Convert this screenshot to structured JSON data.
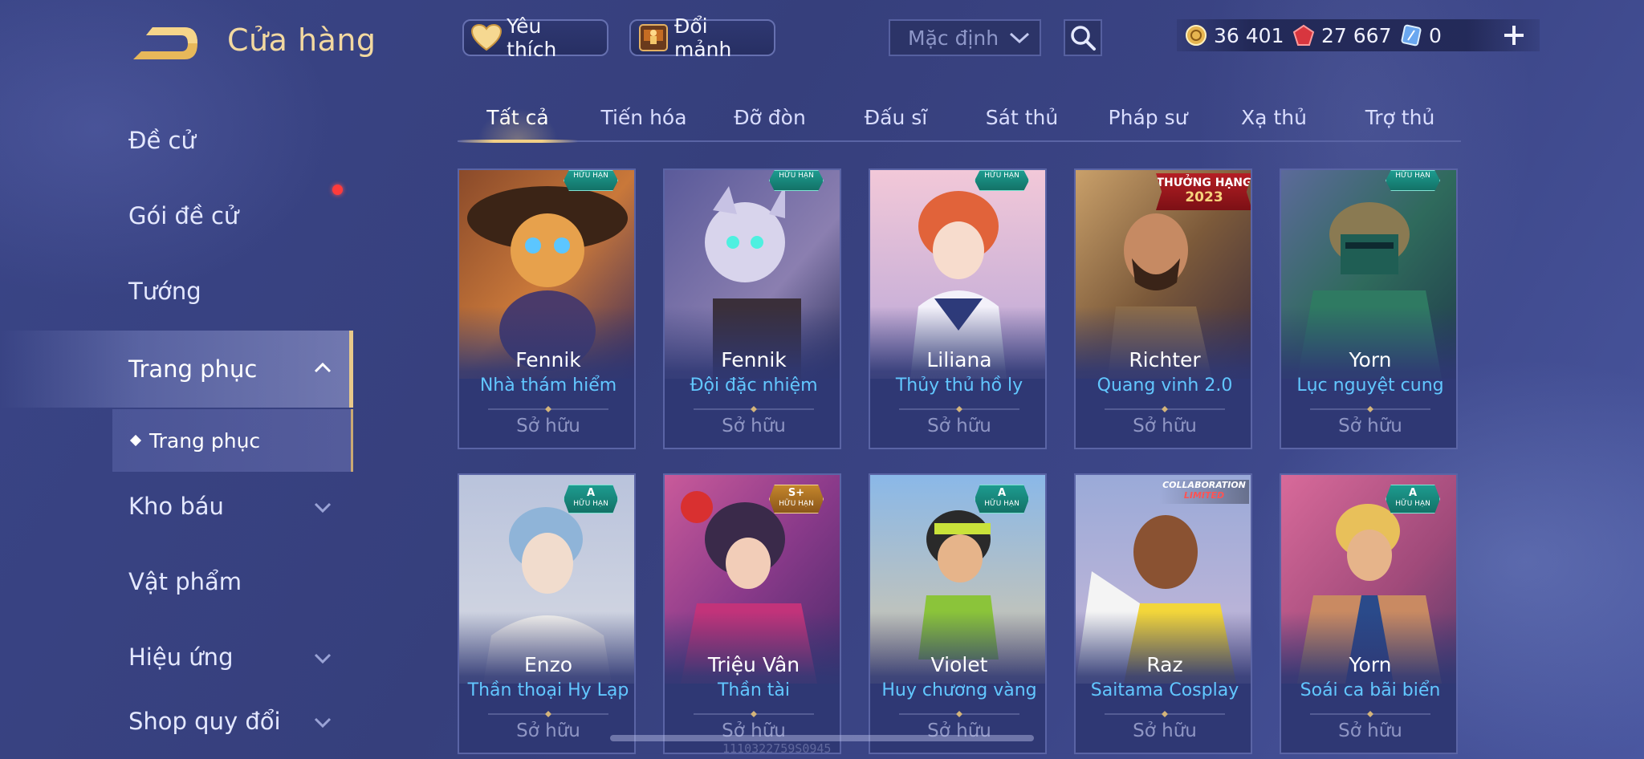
{
  "header": {
    "title": "Cửa hàng",
    "favorite_label": "Yêu thích",
    "shard_label": "Đổi mảnh",
    "sort_value": "Mặc định",
    "currencies": [
      {
        "icon": "gold-coin-icon",
        "value": "36 401"
      },
      {
        "icon": "red-gem-icon",
        "value": "27 667"
      },
      {
        "icon": "blue-voucher-icon",
        "value": "0"
      }
    ]
  },
  "sidebar": {
    "items": [
      {
        "label": "Đề cử"
      },
      {
        "label": "Gói đề cử"
      },
      {
        "label": "Tướng"
      },
      {
        "label": "Trang phục"
      },
      {
        "label": "Kho báu"
      },
      {
        "label": "Vật phẩm"
      },
      {
        "label": "Hiệu ứng"
      },
      {
        "label": "Shop quy đổi"
      }
    ],
    "sub_item": "Trang phục"
  },
  "tabs": [
    "Tất cả",
    "Tiến hóa",
    "Đỡ đòn",
    "Đấu sĩ",
    "Sát thủ",
    "Pháp sư",
    "Xạ thủ",
    "Trợ thủ"
  ],
  "cards": [
    {
      "hero": "Fennik",
      "skin": "Nhà thám hiểm",
      "status": "Sở hữu",
      "badge": "HỮU HẠN"
    },
    {
      "hero": "Fennik",
      "skin": "Đội đặc nhiệm",
      "status": "Sở hữu",
      "badge": "HỮU HẠN"
    },
    {
      "hero": "Liliana",
      "skin": "Thủy thủ hồ ly",
      "status": "Sở hữu",
      "badge": "HỮU HẠN"
    },
    {
      "hero": "Richter",
      "skin": "Quang vinh 2.0",
      "status": "Sở hữu",
      "ribbon": "THƯỞNG HẠNG",
      "ribbon_year": "2023"
    },
    {
      "hero": "Yorn",
      "skin": "Lục nguyệt cung",
      "status": "Sở hữu",
      "badge": "HỮU HẠN"
    },
    {
      "hero": "Enzo",
      "skin": "Thần thoại Hy Lạp",
      "status": "Sở hữu",
      "tier": "A",
      "badge": "HỮU HẠN"
    },
    {
      "hero": "Triệu Vân",
      "skin": "Thần tài",
      "status": "Sở hữu",
      "tier": "S+",
      "badge": "HỮU HẠN"
    },
    {
      "hero": "Violet",
      "skin": "Huy chương vàng",
      "status": "Sở hữu",
      "tier": "A",
      "badge": "HỮU HẠN"
    },
    {
      "hero": "Raz",
      "skin": "Saitama Cosplay",
      "status": "Sở hữu",
      "collab": "COLLABORATION",
      "collab_sub": "LIMITED"
    },
    {
      "hero": "Yorn",
      "skin": "Soái ca bãi biển",
      "status": "Sở hữu",
      "tier": "A",
      "badge": "HỮU HẠN"
    }
  ],
  "footer": {
    "build_id": "1110322759S0945"
  }
}
